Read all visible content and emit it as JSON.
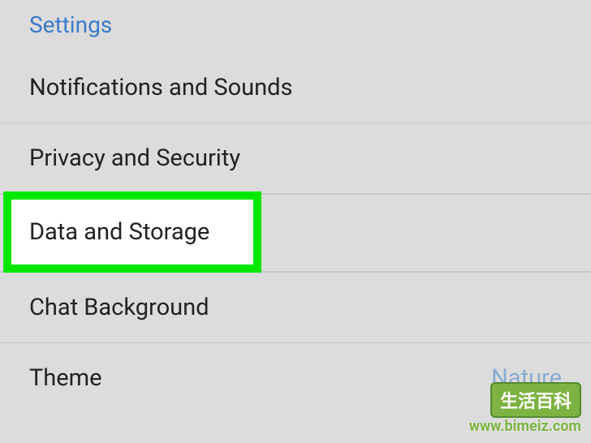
{
  "section_header": "Settings",
  "items": [
    {
      "label": "Notifications and Sounds"
    },
    {
      "label": "Privacy and Security"
    },
    {
      "label": "Data and Storage",
      "highlighted": true
    },
    {
      "label": "Chat Background"
    },
    {
      "label": "Theme",
      "value": "Nature"
    }
  ],
  "watermark": {
    "badge": "生活百科",
    "url": "www.bimeiz.com"
  }
}
